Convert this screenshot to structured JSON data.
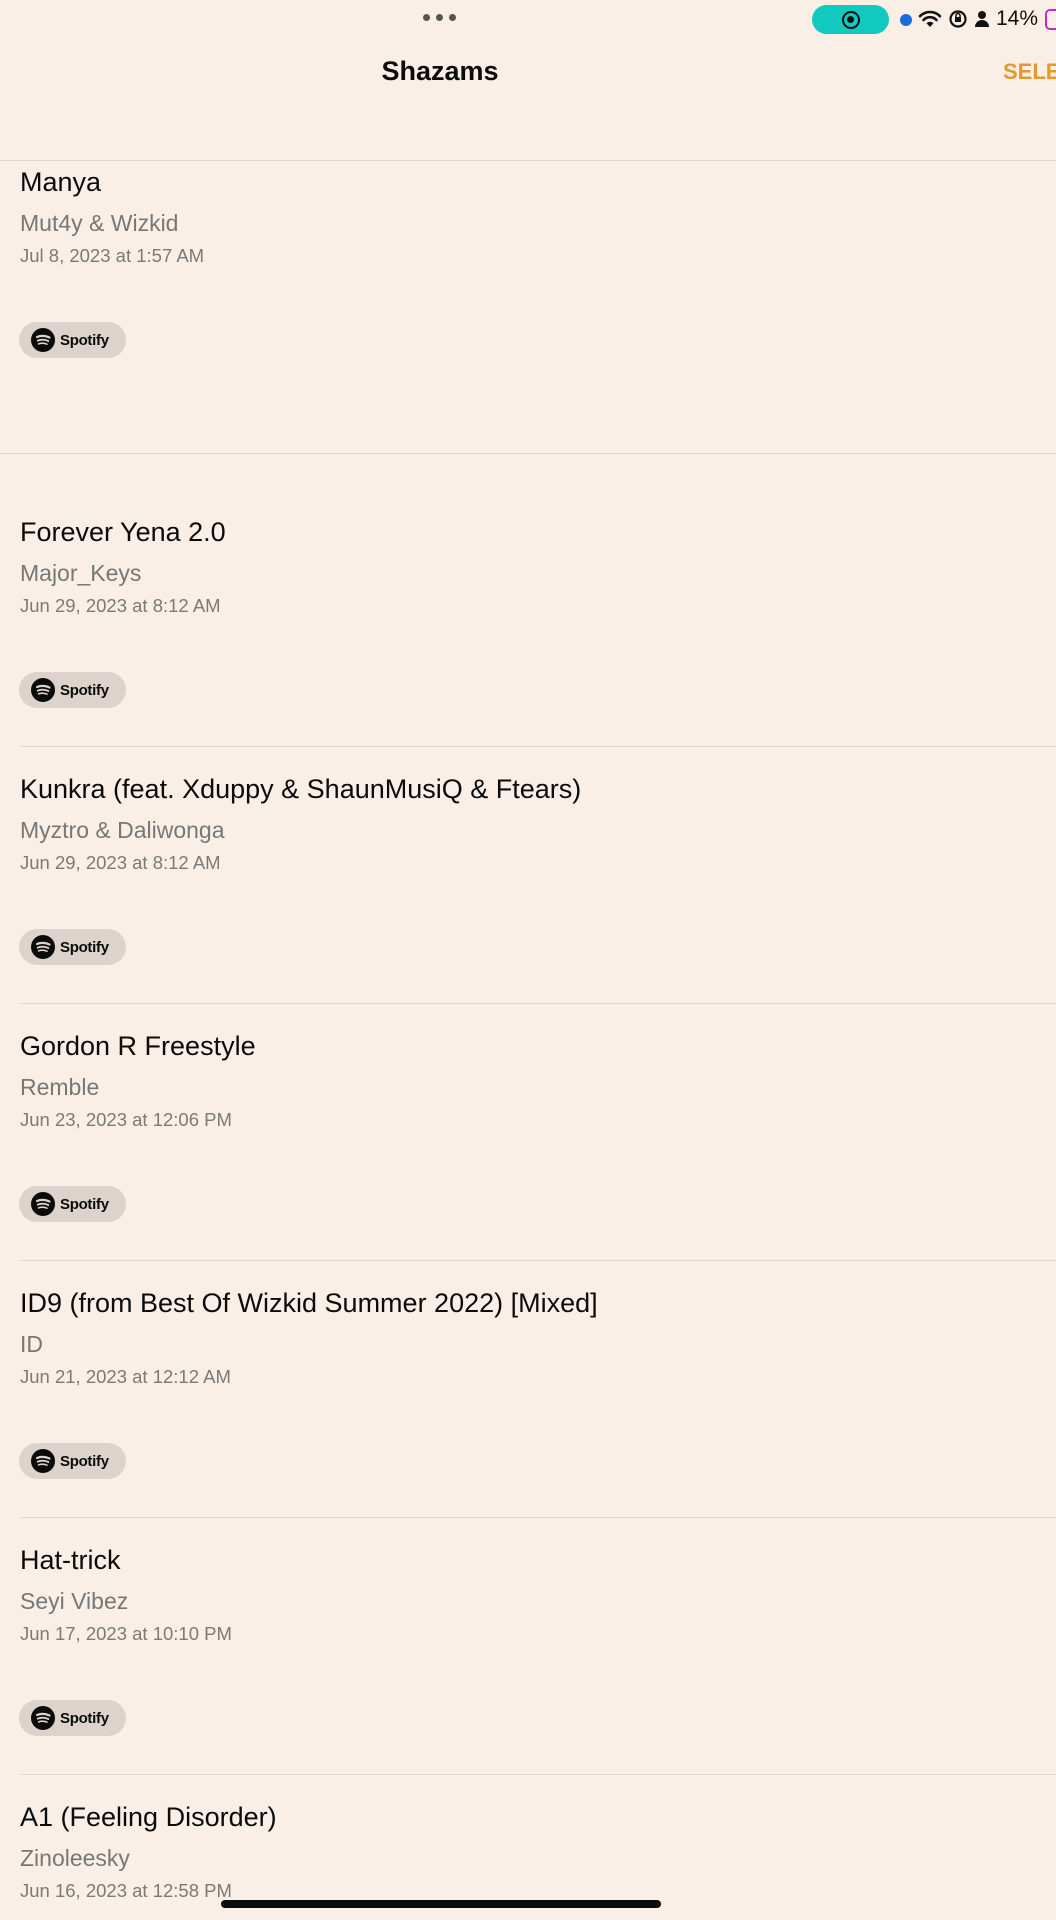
{
  "status": {
    "battery": "14%"
  },
  "nav": {
    "title": "Shazams",
    "select": "SELE"
  },
  "spotify_label": "Spotify",
  "items": [
    {
      "title": "Manya",
      "artist": "Mut4y & Wizkid",
      "date": "Jul 8, 2023 at 1:57 AM"
    },
    {
      "title": "Forever Yena 2.0",
      "artist": "Major_Keys",
      "date": "Jun 29, 2023 at 8:12 AM"
    },
    {
      "title": "Kunkra (feat. Xduppy & ShaunMusiQ & Ftears)",
      "artist": "Myztro & Daliwonga",
      "date": "Jun 29, 2023 at 8:12 AM"
    },
    {
      "title": "Gordon R Freestyle",
      "artist": "Remble",
      "date": "Jun 23, 2023 at 12:06 PM"
    },
    {
      "title": "ID9 (from Best Of Wizkid Summer 2022) [Mixed]",
      "artist": "ID",
      "date": "Jun 21, 2023 at 12:12 AM"
    },
    {
      "title": "Hat-trick",
      "artist": "Seyi Vibez",
      "date": "Jun 17, 2023 at 10:10 PM"
    },
    {
      "title": "A1 (Feeling Disorder)",
      "artist": "Zinoleesky",
      "date": "Jun 16, 2023 at 12:58 PM"
    }
  ]
}
